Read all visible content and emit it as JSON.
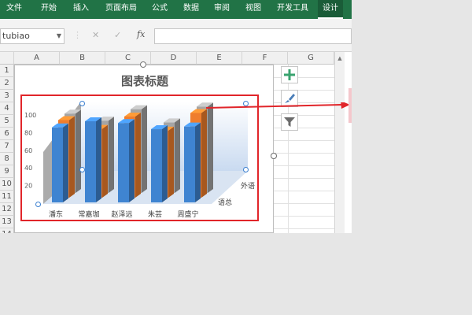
{
  "ribbon": {
    "tabs": [
      "文件",
      "开始",
      "插入",
      "页面布局",
      "公式",
      "数据",
      "审阅",
      "视图",
      "开发工具",
      "设计"
    ],
    "active_tab": "设计"
  },
  "formula_bar": {
    "name_box": "tubiao",
    "fx": "fx"
  },
  "grid": {
    "columns": [
      "A",
      "B",
      "C",
      "D",
      "E",
      "F",
      "G"
    ],
    "rows": [
      "1",
      "2",
      "3",
      "4",
      "5",
      "6",
      "7",
      "8",
      "9",
      "10",
      "11",
      "12",
      "13",
      "14"
    ]
  },
  "colors": {
    "ribbon": "#217346",
    "series1": "#3f84d1",
    "series2": "#ef7d2d",
    "series3": "#a5a5a5",
    "selection": "#e1252a"
  },
  "chart_data": {
    "type": "bar",
    "title": "图表标题",
    "categories": [
      "潘东",
      "常嘉珈",
      "赵泽远",
      "朱芸",
      "周盛宁"
    ],
    "series": [
      {
        "values": [
          85,
          92,
          90,
          83,
          86
        ]
      },
      {
        "values": [
          88,
          78,
          92,
          76,
          96
        ]
      },
      {
        "values": [
          90,
          82,
          95,
          80,
          98
        ]
      }
    ],
    "depth_labels": [
      "语总",
      "外语"
    ],
    "yticks": [
      "20",
      "40",
      "60",
      "80",
      "100"
    ],
    "ylim": [
      0,
      100
    ]
  }
}
